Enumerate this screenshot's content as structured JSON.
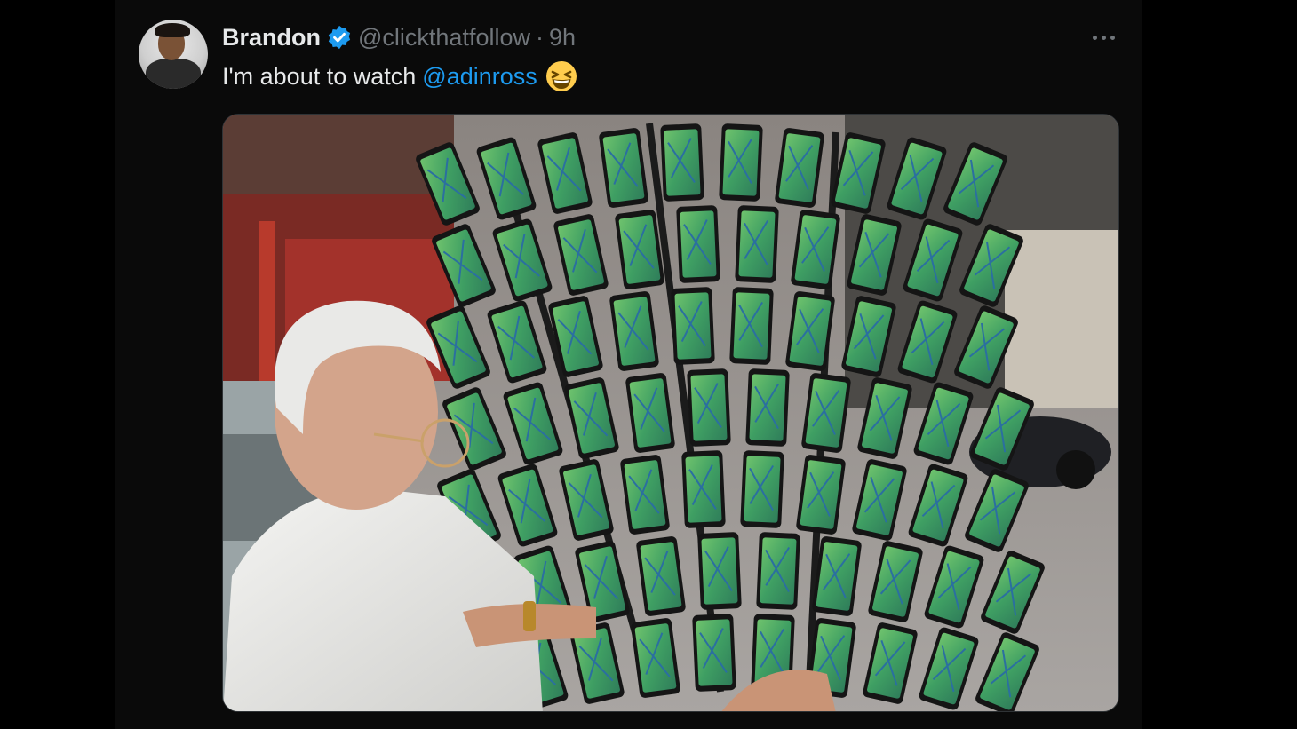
{
  "post": {
    "author": {
      "display_name": "Brandon",
      "handle": "@clickthatfollow",
      "separator": "·",
      "time": "9h",
      "verified": true
    },
    "text": {
      "lead": "I'm about to watch",
      "mention": "@adinross",
      "emoji": "grinning-squinting-face"
    },
    "media": {
      "kind": "photo",
      "caption_shown": false
    }
  },
  "colors": {
    "background": "#000000",
    "primary_text": "#e7e9ea",
    "secondary_text": "#71767b",
    "link": "#1d9bf0",
    "verified_badge": "#1d9bf0"
  }
}
